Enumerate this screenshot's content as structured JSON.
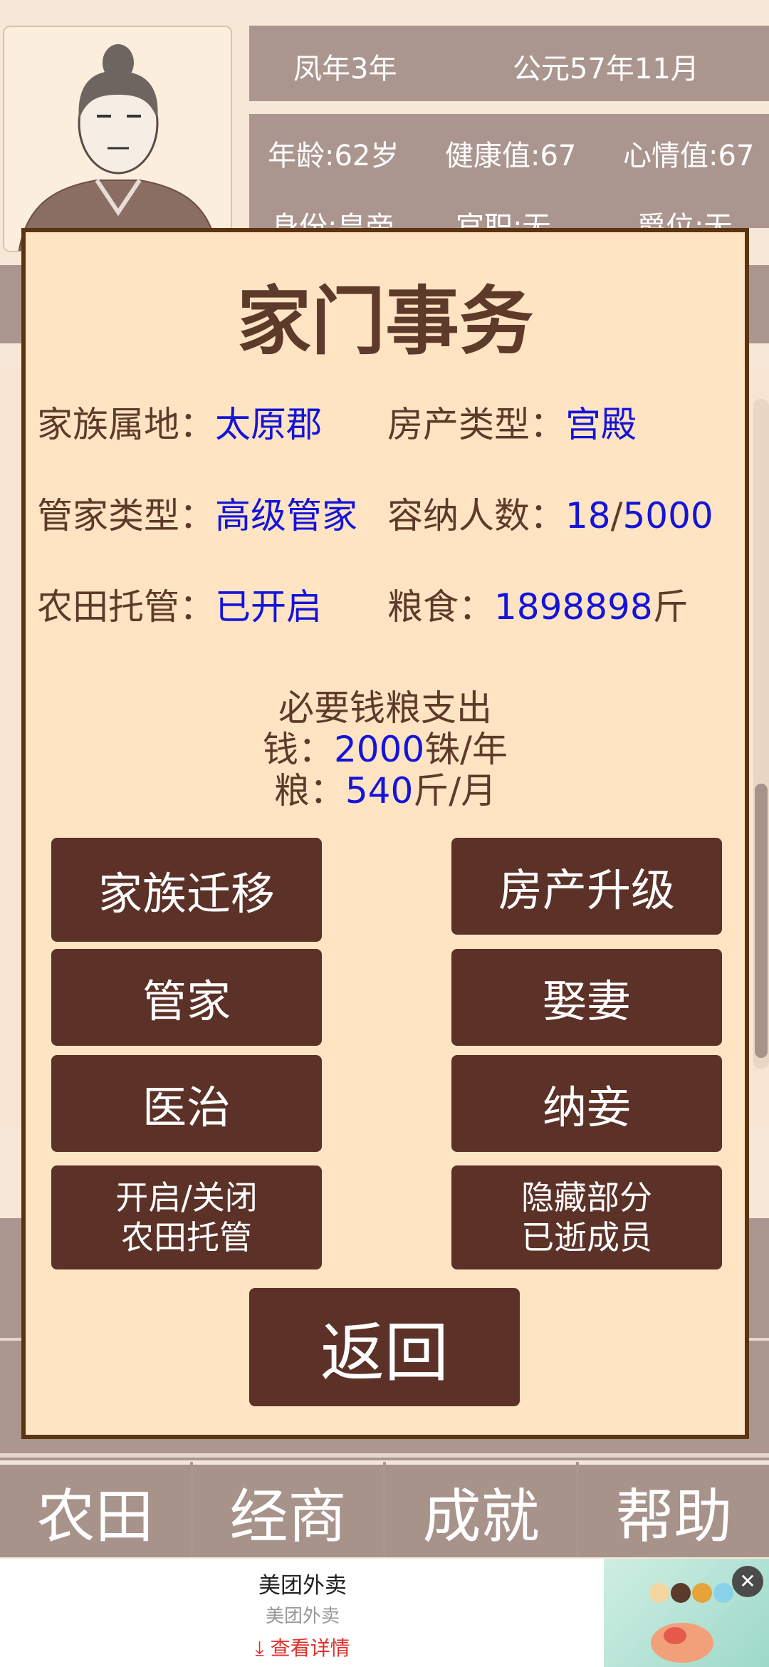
{
  "header": {
    "era": "凤年3年",
    "date": "公元57年11月",
    "age": "年龄:62岁",
    "health": "健康值:67",
    "mood": "心情值:67",
    "status": "身份:皇帝",
    "office": "官职:无",
    "title": "爵位:无"
  },
  "modal": {
    "title": "家门事务",
    "fields": {
      "territory_label": "家族属地：",
      "territory_value": "太原郡",
      "property_label": "房产类型：",
      "property_value": "宫殿",
      "steward_label": "管家类型：",
      "steward_value": "高级管家",
      "capacity_label": "容纳人数：",
      "capacity_current": "18",
      "capacity_sep": "/",
      "capacity_max": "5000",
      "farm_label": "农田托管：",
      "farm_value": "已开启",
      "grain_label": "粮食：",
      "grain_value": "1898898",
      "grain_unit": "斤"
    },
    "expenses": {
      "title": "必要钱粮支出",
      "money_label": "钱：",
      "money_value": "2000",
      "money_unit": "铢/年",
      "grain_label": "粮：",
      "grain_value": "540",
      "grain_unit": "斤/月"
    },
    "buttons": {
      "migrate": "家族迁移",
      "upgrade": "房产升级",
      "steward": "管家",
      "marry": "娶妻",
      "heal": "医治",
      "concubine": "纳妾",
      "farm_toggle_1": "开启/关闭",
      "farm_toggle_2": "农田托管",
      "hide_dead_1": "隐藏部分",
      "hide_dead_2": "已逝成员",
      "back": "返回"
    }
  },
  "nav": {
    "farm": "农田",
    "trade": "经商",
    "achievement": "成就",
    "help": "帮助"
  },
  "ad": {
    "title": "美团外卖",
    "subtitle": "美团外卖",
    "link": "查看详情",
    "close": "✕"
  }
}
